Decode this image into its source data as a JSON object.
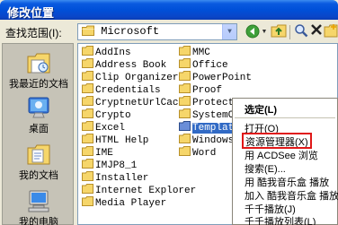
{
  "window": {
    "title": "修改位置"
  },
  "toolbar": {
    "look_in_label": "查找范围(I):",
    "look_in_value": "Microsoft"
  },
  "places": [
    {
      "label": "我最近的文档",
      "icon": "recent-documents-icon"
    },
    {
      "label": "桌面",
      "icon": "desktop-icon"
    },
    {
      "label": "我的文档",
      "icon": "my-documents-icon"
    },
    {
      "label": "我的电脑",
      "icon": "my-computer-icon"
    }
  ],
  "files": {
    "col1": [
      "AddIns",
      "Address Book",
      "Clip Organizer",
      "Credentials",
      "CryptnetUrlCache",
      "Crypto",
      "Excel",
      "HTML Help",
      "IME",
      "IMJP8_1",
      "Installer",
      "Internet Explorer",
      "Media Player"
    ],
    "col2": [
      "MMC",
      "Office",
      "PowerPoint",
      "Proof",
      "Protect",
      "SystemCer",
      "Templates",
      "Windows",
      "Word"
    ]
  },
  "selected_folder": "Templates",
  "context_menu": {
    "items": [
      "选定(L)",
      "打开(O)",
      "资源管理器(X)",
      "用 ACDSee 浏览",
      "搜索(E)...",
      "用 酷我音乐盒 播放",
      "加入 酷我音乐盒 播放",
      "千千播放(J)",
      "千千播放列表(L)"
    ],
    "highlighted": "资源管理器(X)",
    "highlight_color": "#e01818"
  },
  "colors": {
    "title_bar": "#0050d8",
    "selection": "#316ac5",
    "folder": "#f0cc5c"
  }
}
